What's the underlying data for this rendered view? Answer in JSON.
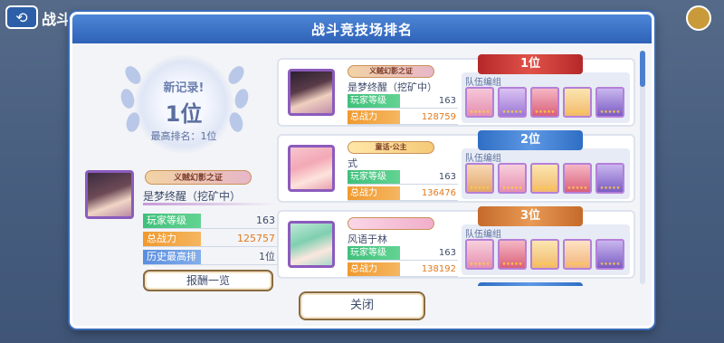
{
  "background": {
    "screen_title": "战斗",
    "back_icon": "back-arrow-icon"
  },
  "dialog": {
    "title": "战斗竞技场排名",
    "close_label": "关闭",
    "colors": {
      "header": "#3a6bb8",
      "accent_green": "#3fc07b",
      "accent_orange": "#f0992e",
      "accent_blue": "#5a8ede"
    }
  },
  "record": {
    "new_record_label": "新记录!",
    "rank_text": "1位",
    "best_rank_text": "最高排名：1位"
  },
  "me": {
    "badge": "义贼幻影之证",
    "name": "是梦终醒（挖矿中）",
    "level_label": "玩家等级",
    "level_value": "163",
    "power_label": "总战力",
    "power_value": "125757",
    "history_label": "历史最高排名",
    "history_value": "1位",
    "reward_button": "报酬一览"
  },
  "ranking": [
    {
      "rank_text": "1位",
      "badge": "义贼幻影之证",
      "name": "是梦终醒（挖矿中）",
      "level_label": "玩家等级",
      "level_value": "163",
      "power_label": "总战力",
      "power_value": "128759",
      "team_label": "队伍编组"
    },
    {
      "rank_text": "2位",
      "badge": "童话·公主",
      "name": "式",
      "level_label": "玩家等级",
      "level_value": "163",
      "power_label": "总战力",
      "power_value": "136476",
      "team_label": "队伍编组"
    },
    {
      "rank_text": "3位",
      "badge": "",
      "name": "风语于林",
      "level_label": "玩家等级",
      "level_value": "163",
      "power_label": "总战力",
      "power_value": "138192",
      "team_label": "队伍编组"
    }
  ]
}
